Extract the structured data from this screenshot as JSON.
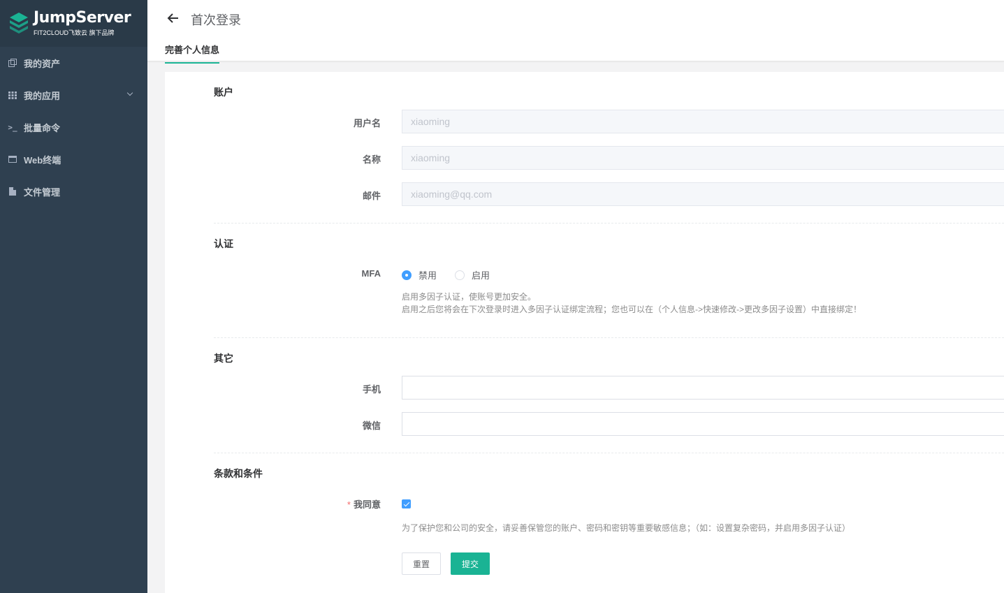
{
  "brand": {
    "title": "JumpServer",
    "subtitle": "FIT2CLOUD飞致云 旗下品牌"
  },
  "sidebar": {
    "items": [
      {
        "label": "我的资产",
        "icon": "assets-icon"
      },
      {
        "label": "我的应用",
        "icon": "apps-grid-icon",
        "expandable": true
      },
      {
        "label": "批量命令",
        "icon": "terminal-icon"
      },
      {
        "label": "Web终端",
        "icon": "window-icon"
      },
      {
        "label": "文件管理",
        "icon": "file-icon"
      }
    ]
  },
  "header": {
    "title": "首次登录",
    "tab": "完善个人信息"
  },
  "form": {
    "account": {
      "title": "账户",
      "username_label": "用户名",
      "username_value": "xiaoming",
      "name_label": "名称",
      "name_value": "xiaoming",
      "email_label": "邮件",
      "email_value": "xiaoming@qq.com"
    },
    "auth": {
      "title": "认证",
      "mfa_label": "MFA",
      "mfa_options": [
        "禁用",
        "启用"
      ],
      "mfa_selected": "禁用",
      "help_line1": "启用多因子认证，使账号更加安全。",
      "help_line2": "启用之后您将会在下次登录时进入多因子认证绑定流程；您也可以在（个人信息->快速修改->更改多因子设置）中直接绑定！"
    },
    "other": {
      "title": "其它",
      "phone_label": "手机",
      "phone_value": "",
      "wechat_label": "微信",
      "wechat_value": ""
    },
    "terms": {
      "title": "条款和条件",
      "required_mark": "*",
      "agree_label": "我同意",
      "agree_checked": true,
      "help": "为了保护您和公司的安全，请妥善保管您的账户、密码和密钥等重要敏感信息；（如：设置复杂密码，并启用多因子认证）"
    },
    "buttons": {
      "reset": "重置",
      "submit": "提交"
    }
  },
  "colors": {
    "sidebar_bg": "#2f4050",
    "accent": "#1ab394",
    "radio_checked": "#409eff"
  }
}
